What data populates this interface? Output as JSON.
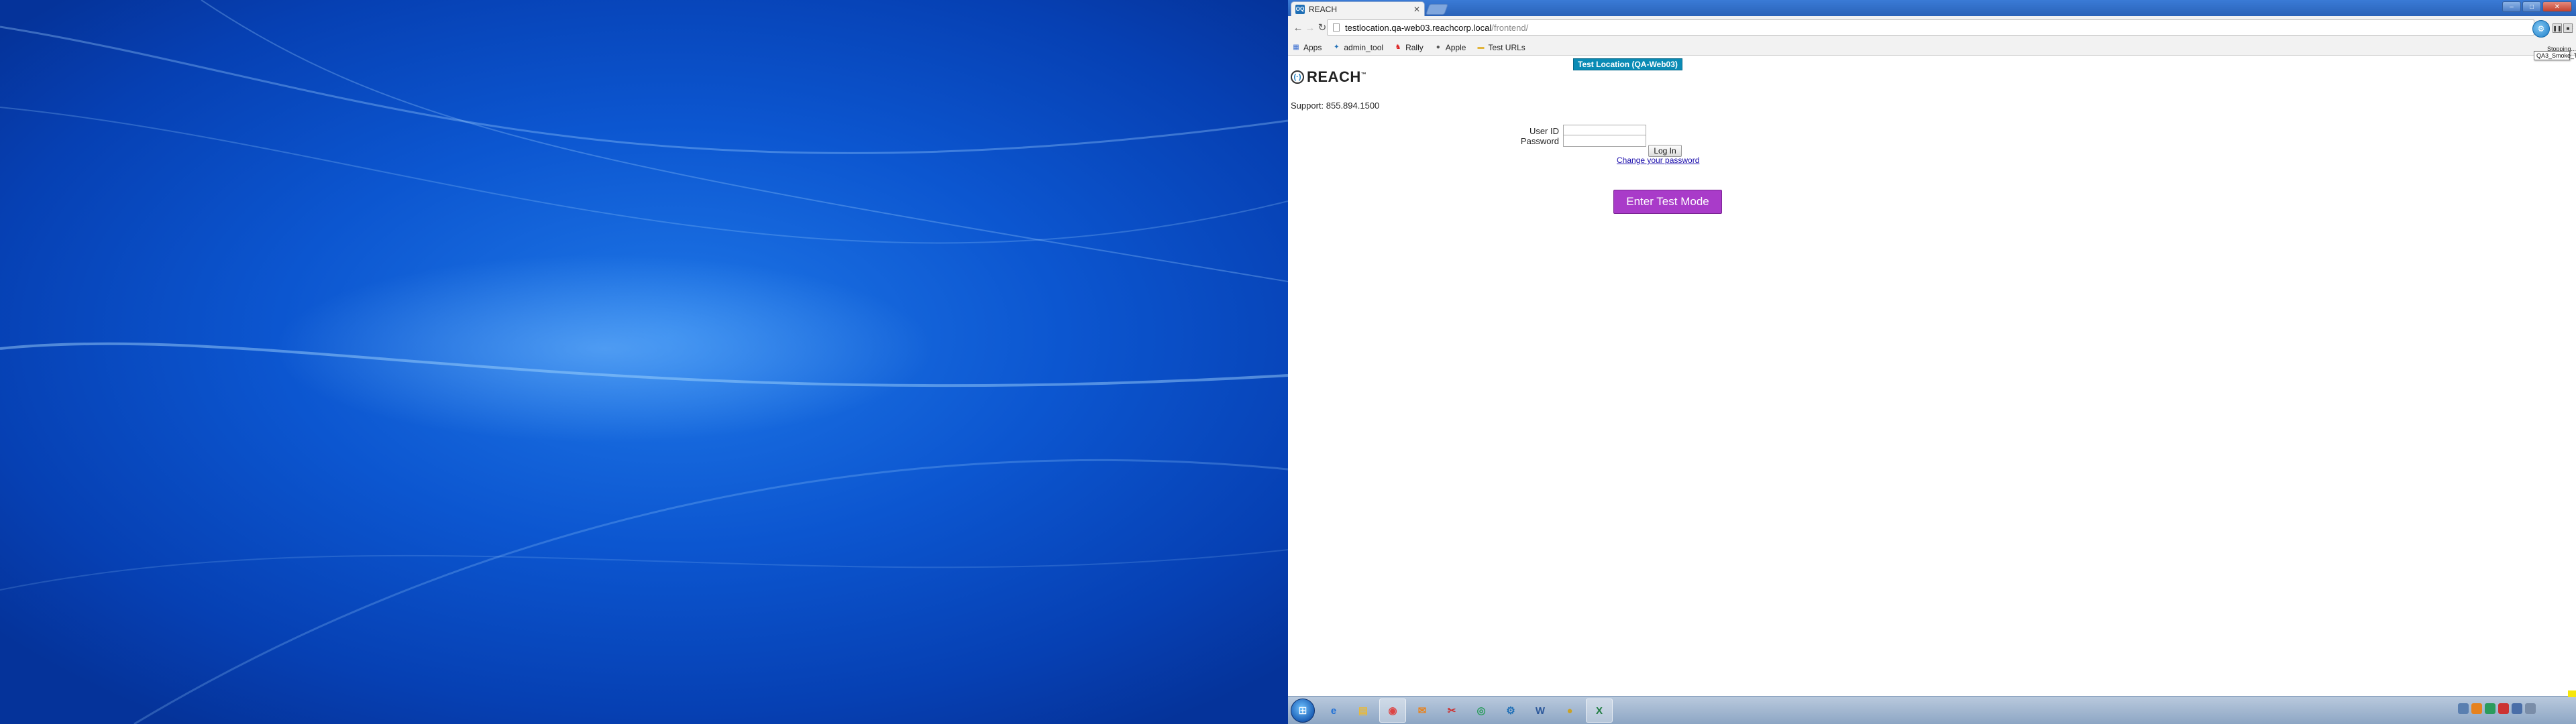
{
  "browser": {
    "tab_title": "REACH",
    "favicon_text": "OQ",
    "url_host": "testlocation.qa-web03.reachcorp.local",
    "url_path": "/frontend/"
  },
  "bookmarks": [
    {
      "label": "Apps",
      "icon": "apps-grid-icon"
    },
    {
      "label": "admin_tool",
      "icon": "tool-icon"
    },
    {
      "label": "Rally",
      "icon": "rally-icon"
    },
    {
      "label": "Apple",
      "icon": "apple-icon"
    },
    {
      "label": "Test URLs",
      "icon": "folder-icon"
    }
  ],
  "page": {
    "env_banner": "Test Location (QA-Web03)",
    "logo_text": "REACH",
    "logo_tm": "™",
    "support": "Support: 855.894.1500",
    "user_id_label": "User ID",
    "password_label": "Password",
    "login_button": "Log In",
    "change_password_link": "Change your password",
    "test_mode_button": "Enter Test Mode"
  },
  "automation": {
    "status": "Stopping...",
    "suite": "QA3_Smoke_Tests"
  },
  "colors": {
    "banner": "#0a8bb5",
    "test_mode": "#a93bc9",
    "link": "#1a0dab",
    "wallpaper": "#0a4fbd"
  }
}
